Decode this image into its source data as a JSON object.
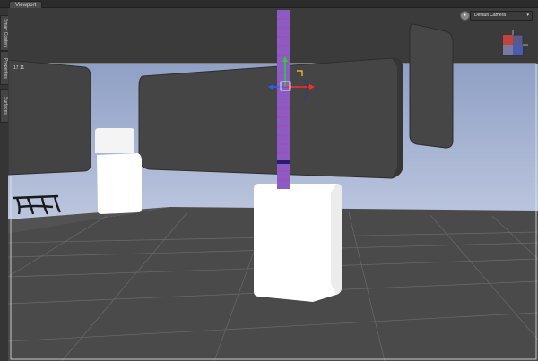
{
  "window": {
    "tab_label": "Viewport"
  },
  "side_tabs": [
    "Smart Content",
    "Properties",
    "Surfaces"
  ],
  "viewport": {
    "camera_label": "Default Camera",
    "coords": "17  11"
  },
  "colors": {
    "sky": "#a9b6d2",
    "floor": "#4b4b4b",
    "grid": "#6e6e6e",
    "panel_dark": "#454545",
    "white_prop": "#ffffff",
    "selection": "#8d4dbf"
  },
  "icons": {
    "camera": "camera-icon",
    "nav_cube": "nav-cube-icon",
    "gizmo": "transform-gizmo-icon"
  }
}
